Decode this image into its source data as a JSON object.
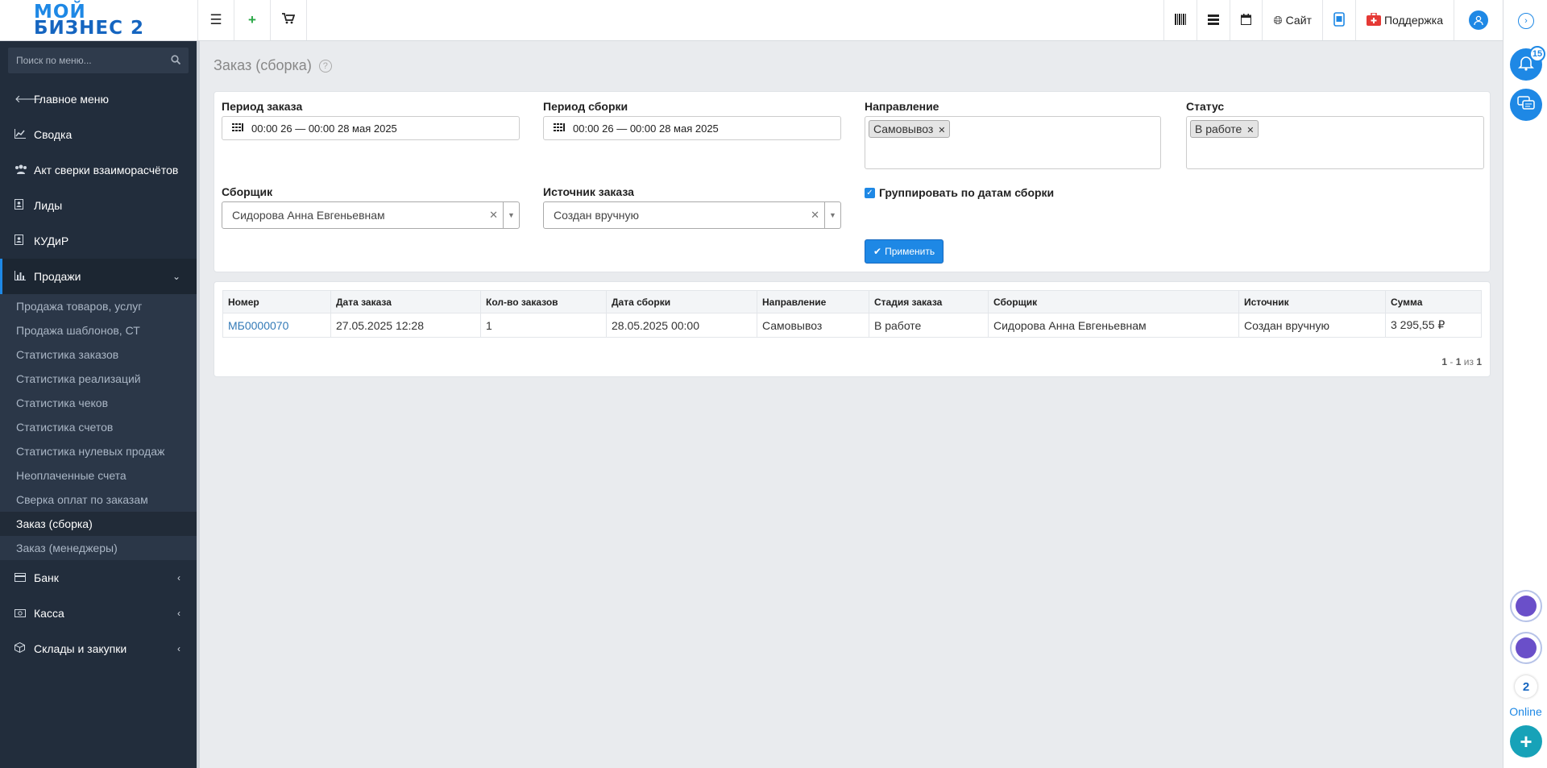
{
  "logo": {
    "line1": "МОЙ",
    "line2": "БИЗНЕС 2"
  },
  "topbar": {
    "site_label": "Сайт",
    "support_label": "Поддержка"
  },
  "rail": {
    "notifications_count": "15",
    "online_count": "2",
    "online_label": "Online"
  },
  "sidebar": {
    "search_placeholder": "Поиск по меню...",
    "items": [
      {
        "label": "Главное меню",
        "icon": "arrow-left-icon"
      },
      {
        "label": "Сводка",
        "icon": "line-chart-icon"
      },
      {
        "label": "Акт сверки взаиморасчётов",
        "icon": "users-icon"
      },
      {
        "label": "Лиды",
        "icon": "contact-icon"
      },
      {
        "label": "КУДиР",
        "icon": "contact-icon"
      },
      {
        "label": "Продажи",
        "icon": "bar-chart-icon"
      }
    ],
    "sales_submenu": [
      "Продажа товаров, услуг",
      "Продажа шаблонов, СТ",
      "Статистика заказов",
      "Статистика реализаций",
      "Статистика чеков",
      "Статистика счетов",
      "Статистика нулевых продаж",
      "Неоплаченные счета",
      "Сверка оплат по заказам",
      "Заказ (сборка)",
      "Заказ (менеджеры)"
    ],
    "bottom_items": [
      {
        "label": "Банк",
        "icon": "card-icon"
      },
      {
        "label": "Касса",
        "icon": "cash-icon"
      },
      {
        "label": "Склады и закупки",
        "icon": "box-icon"
      }
    ]
  },
  "page": {
    "title": "Заказ (сборка)"
  },
  "filters": {
    "order_period_label": "Период заказа",
    "order_period_value": "00:00 26 — 00:00 28 мая 2025",
    "assembly_period_label": "Период сборки",
    "assembly_period_value": "00:00 26 — 00:00 28 мая 2025",
    "direction_label": "Направление",
    "direction_tag": "Самовывоз",
    "status_label": "Статус",
    "status_tag": "В работе",
    "assembler_label": "Сборщик",
    "assembler_value": "Сидорова Анна Евгеньевнам",
    "source_label": "Источник заказа",
    "source_value": "Создан вручную",
    "group_label": "Группировать по датам сборки",
    "apply_label": "Применить"
  },
  "table": {
    "headers": [
      "Номер",
      "Дата заказа",
      "Кол-во заказов",
      "Дата сборки",
      "Направление",
      "Стадия заказа",
      "Сборщик",
      "Источник",
      "Сумма"
    ],
    "rows": [
      [
        "МБ0000070",
        "27.05.2025 12:28",
        "1",
        "28.05.2025 00:00",
        "Самовывоз",
        "В работе",
        "Сидорова Анна Евгеньевнам",
        "Создан вручную",
        "3 295,55 ₽"
      ]
    ],
    "pager": {
      "from": "1",
      "to": "1",
      "sep": "из",
      "total": "1"
    }
  }
}
